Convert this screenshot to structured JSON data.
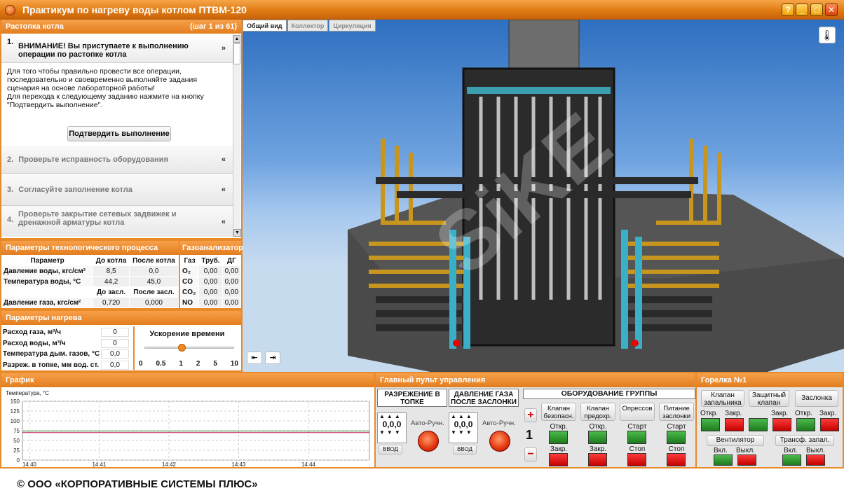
{
  "window": {
    "title": "Практикум по нагреву воды котлом ПТВМ-120",
    "buttons": [
      "?",
      "_",
      "□",
      "✕"
    ]
  },
  "steps_panel": {
    "title": "Растопка котла",
    "counter": "(шаг 1 из 61)",
    "steps": [
      {
        "num": "1.",
        "text": "ВНИМАНИЕ! Вы приступаете к выполнению операции по растопке котла",
        "expanded": true
      },
      {
        "num": "2.",
        "text": "Проверьте исправность оборудования"
      },
      {
        "num": "3.",
        "text": "Согласуйте заполнение котла"
      },
      {
        "num": "4.",
        "text": "Проверьте закрытие сетевых задвижек и дренажной арматуры котла"
      }
    ],
    "step1_body": "Для того чтобы правильно провести все операции, последовательно и своевременно выполняйте задания сценария на основе лабораторной работы!\nДля перехода к следующему заданию нажмите на кнопку \"Подтвердить выполнение\".",
    "confirm_button": "Подтвердить выполнение"
  },
  "process_params": {
    "title": "Параметры технологического процесса",
    "headers": [
      "Параметр",
      "До котла",
      "После котла"
    ],
    "rows": [
      {
        "name": "Давление воды, кгс/см²",
        "before": "8,5",
        "after": "0,0"
      },
      {
        "name": "Температура воды, °C",
        "before": "44,2",
        "after": "45,0"
      }
    ],
    "gas_headers": [
      "До засл.",
      "После засл."
    ],
    "gas_row": {
      "name": "Давление газа, кгс/см²",
      "before": "0,720",
      "after": "0,000"
    }
  },
  "gas_analyzer": {
    "title": "Газоанализатор",
    "headers": [
      "Газ",
      "Труб.",
      "ДГ"
    ],
    "rows": [
      {
        "gas": "O₂",
        "tube": "0,00",
        "dg": "0,00"
      },
      {
        "gas": "CO",
        "tube": "0,00",
        "dg": "0,00"
      },
      {
        "gas": "CO₂",
        "tube": "0,00",
        "dg": "0,00"
      },
      {
        "gas": "NO",
        "tube": "0,00",
        "dg": "0,00"
      }
    ]
  },
  "heating_params": {
    "title": "Параметры нагрева",
    "rows": [
      {
        "label": "Расход газа, м³/ч",
        "value": "0"
      },
      {
        "label": "Расход воды, м³/ч",
        "value": "0"
      },
      {
        "label": "Температура дым. газов, °C",
        "value": "0,0"
      },
      {
        "label": "Разреж. в топке, мм вод. ст.",
        "value": "0,0"
      }
    ]
  },
  "time_accel": {
    "title": "Ускорение времени",
    "ticks": [
      "0",
      "0.5",
      "1",
      "2",
      "5",
      "10"
    ],
    "current": "1"
  },
  "scene": {
    "tabs": [
      "Общий вид",
      "Коллектор",
      "Циркуляция"
    ],
    "active_tab": "Общий вид",
    "watermark": "SiKE",
    "prev": "⇤",
    "next": "⇥"
  },
  "graph": {
    "title": "График",
    "ylabel": "Температура, °C",
    "yticks": [
      "150",
      "125",
      "100",
      "75",
      "50",
      "25",
      "0"
    ],
    "xticks": [
      "14:40",
      "14:41",
      "14:42",
      "14:43",
      "14:44"
    ]
  },
  "chart_data": {
    "type": "line",
    "title": "",
    "xlabel": "",
    "ylabel": "Температура, °C",
    "ylim": [
      0,
      150
    ],
    "x": [
      "14:40",
      "14:41",
      "14:42",
      "14:43",
      "14:44"
    ],
    "series": [
      {
        "color": "#2e7d32",
        "values": [
          74,
          74,
          74,
          74,
          74
        ]
      },
      {
        "color": "#c2185b",
        "values": [
          70,
          70,
          70,
          70,
          70
        ]
      }
    ],
    "grid": true
  },
  "control": {
    "title": "Главный пульт управления",
    "vacuum": {
      "title": "РАЗРЕЖЕНИЕ В ТОПКЕ",
      "value": [
        "0",
        "0",
        "0"
      ],
      "enter": "ВВОД",
      "mode": "Авто-Ручн."
    },
    "gas_pressure": {
      "title": "ДАВЛЕНИЕ ГАЗА ПОСЛЕ ЗАСЛОНКИ",
      "value": [
        "0",
        "0",
        "0"
      ],
      "enter": "ВВОД",
      "mode": "Авто-Ручн."
    },
    "group": {
      "title": "ОБОРУДОВАНИЕ ГРУППЫ",
      "number": "1",
      "plus": "+",
      "minus": "−",
      "items": [
        {
          "label": "Клапан безопасн.",
          "top": "Откр.",
          "bottom": "Закр."
        },
        {
          "label": "Клапан предохр.",
          "top": "Откр.",
          "bottom": "Закр."
        },
        {
          "label": "Опрессов",
          "top": "Старт",
          "bottom": "Стоп"
        },
        {
          "label": "Питание заслонки",
          "top": "Старт",
          "bottom": "Стоп"
        }
      ]
    }
  },
  "burner": {
    "title": "Горелка №1",
    "buttons": [
      "Клапан запальника",
      "Защитный клапан",
      "Заслонка"
    ],
    "open": "Откр.",
    "close": "Закр.",
    "fan": "Вентилятор",
    "ignition": "Трансф. запал.",
    "on": "Вкл.",
    "off": "Выкл."
  },
  "footer": {
    "copyright": "© ООО «КОРПОРАТИВНЫЕ СИСТЕМЫ ПЛЮС»"
  }
}
